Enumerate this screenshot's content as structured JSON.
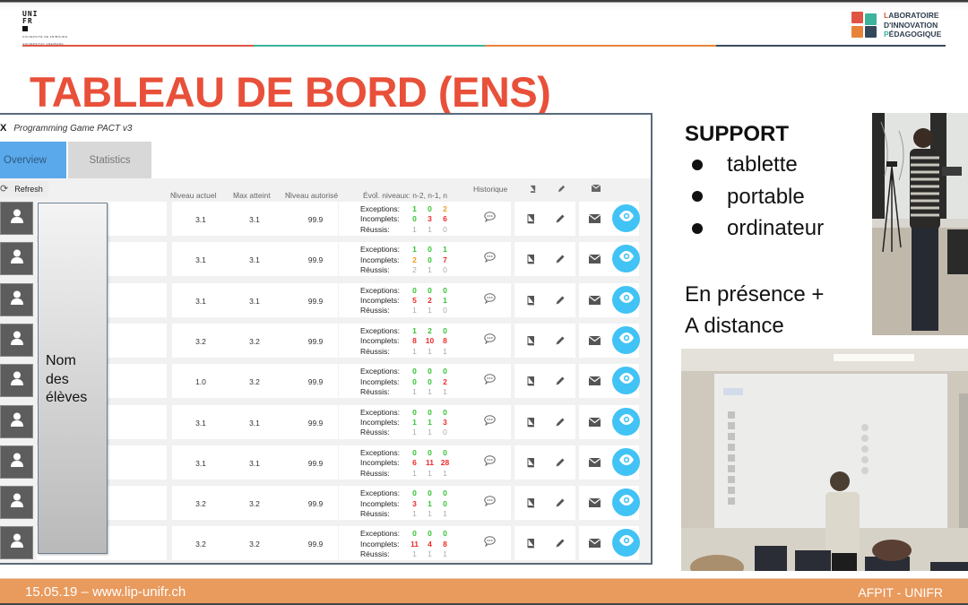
{
  "slide": {
    "title": "TABLEAU DE BORD (ENS)",
    "university_logo": {
      "letters_line1": "UNI",
      "letters_line2": "FR",
      "subtitle_line1": "UNIVERSITÉ DE FRIBOURG",
      "subtitle_line2": "UNIVERSITÄT FREIBURG"
    },
    "lab_logo": {
      "line1_initial": "L",
      "line1_rest": "ABORATOIRE",
      "line2_initial": "D'I",
      "line2_rest": "NNOVATION",
      "line3_initial": "P",
      "line3_rest": "ÉDAGOGIQUE"
    },
    "rule_colors": [
      "#e05443",
      "#3cb39b",
      "#e8843a",
      "#3b4a5c"
    ],
    "footer": {
      "left": "15.05.19 – www.lip-unifr.ch",
      "right": "AFPIT - UNIFR"
    }
  },
  "app": {
    "close_label": "X",
    "title": "Programming Game PACT v3",
    "tabs": [
      {
        "label": "Overview",
        "active": true
      },
      {
        "label": "Statistics",
        "active": false
      }
    ],
    "refresh_label": "Refresh",
    "columns": {
      "niveau_actuel": "Niveau actuel",
      "max_atteint": "Max atteint",
      "niveau_autorise": "Niveau autorisé",
      "evolution": "Évol. niveaux: n-2, n-1, n",
      "historique": "Historique",
      "sort_glyph": "⇕"
    },
    "row_labels": {
      "exceptions": "Exceptions:",
      "incomplets": "Incomplets:",
      "reussis": "Réussis:"
    },
    "name_overlay": [
      "Nom",
      "des",
      "élèves"
    ],
    "accent_color": "#41c3f5",
    "rows": [
      {
        "niveau_actuel": "3.1",
        "max_atteint": "3.1",
        "niveau_autorise": "99.9",
        "exceptions": [
          {
            "v": "1",
            "c": "g"
          },
          {
            "v": "0",
            "c": "g"
          },
          {
            "v": "2",
            "c": "o"
          }
        ],
        "incomplets": [
          {
            "v": "0",
            "c": "g"
          },
          {
            "v": "3",
            "c": "r"
          },
          {
            "v": "6",
            "c": "r"
          }
        ],
        "reussis": [
          {
            "v": "1",
            "c": "z"
          },
          {
            "v": "1",
            "c": "z"
          },
          {
            "v": "0",
            "c": "z"
          }
        ]
      },
      {
        "niveau_actuel": "3.1",
        "max_atteint": "3.1",
        "niveau_autorise": "99.9",
        "exceptions": [
          {
            "v": "1",
            "c": "g"
          },
          {
            "v": "0",
            "c": "g"
          },
          {
            "v": "1",
            "c": "g"
          }
        ],
        "incomplets": [
          {
            "v": "2",
            "c": "o"
          },
          {
            "v": "0",
            "c": "g"
          },
          {
            "v": "7",
            "c": "r"
          }
        ],
        "reussis": [
          {
            "v": "2",
            "c": "z"
          },
          {
            "v": "1",
            "c": "z"
          },
          {
            "v": "0",
            "c": "z"
          }
        ]
      },
      {
        "niveau_actuel": "3.1",
        "max_atteint": "3.1",
        "niveau_autorise": "99.9",
        "exceptions": [
          {
            "v": "0",
            "c": "g"
          },
          {
            "v": "0",
            "c": "g"
          },
          {
            "v": "0",
            "c": "g"
          }
        ],
        "incomplets": [
          {
            "v": "5",
            "c": "r"
          },
          {
            "v": "2",
            "c": "r"
          },
          {
            "v": "1",
            "c": "g"
          }
        ],
        "reussis": [
          {
            "v": "1",
            "c": "z"
          },
          {
            "v": "1",
            "c": "z"
          },
          {
            "v": "0",
            "c": "z"
          }
        ]
      },
      {
        "niveau_actuel": "3.2",
        "max_atteint": "3.2",
        "niveau_autorise": "99.9",
        "exceptions": [
          {
            "v": "1",
            "c": "g"
          },
          {
            "v": "2",
            "c": "g"
          },
          {
            "v": "0",
            "c": "g"
          }
        ],
        "incomplets": [
          {
            "v": "8",
            "c": "r"
          },
          {
            "v": "10",
            "c": "r"
          },
          {
            "v": "8",
            "c": "r"
          }
        ],
        "reussis": [
          {
            "v": "1",
            "c": "z"
          },
          {
            "v": "1",
            "c": "z"
          },
          {
            "v": "1",
            "c": "z"
          }
        ]
      },
      {
        "niveau_actuel": "1.0",
        "max_atteint": "3.2",
        "niveau_autorise": "99.9",
        "exceptions": [
          {
            "v": "0",
            "c": "g"
          },
          {
            "v": "0",
            "c": "g"
          },
          {
            "v": "0",
            "c": "g"
          }
        ],
        "incomplets": [
          {
            "v": "0",
            "c": "g"
          },
          {
            "v": "0",
            "c": "g"
          },
          {
            "v": "2",
            "c": "r"
          }
        ],
        "reussis": [
          {
            "v": "1",
            "c": "z"
          },
          {
            "v": "1",
            "c": "z"
          },
          {
            "v": "1",
            "c": "z"
          }
        ]
      },
      {
        "niveau_actuel": "3.1",
        "max_atteint": "3.1",
        "niveau_autorise": "99.9",
        "exceptions": [
          {
            "v": "0",
            "c": "g"
          },
          {
            "v": "0",
            "c": "g"
          },
          {
            "v": "0",
            "c": "g"
          }
        ],
        "incomplets": [
          {
            "v": "1",
            "c": "g"
          },
          {
            "v": "1",
            "c": "g"
          },
          {
            "v": "3",
            "c": "r"
          }
        ],
        "reussis": [
          {
            "v": "1",
            "c": "z"
          },
          {
            "v": "1",
            "c": "z"
          },
          {
            "v": "0",
            "c": "z"
          }
        ]
      },
      {
        "niveau_actuel": "3.1",
        "max_atteint": "3.1",
        "niveau_autorise": "99.9",
        "exceptions": [
          {
            "v": "0",
            "c": "g"
          },
          {
            "v": "0",
            "c": "g"
          },
          {
            "v": "0",
            "c": "g"
          }
        ],
        "incomplets": [
          {
            "v": "6",
            "c": "r"
          },
          {
            "v": "11",
            "c": "r"
          },
          {
            "v": "28",
            "c": "r"
          }
        ],
        "reussis": [
          {
            "v": "1",
            "c": "z"
          },
          {
            "v": "1",
            "c": "z"
          },
          {
            "v": "1",
            "c": "z"
          }
        ]
      },
      {
        "niveau_actuel": "3.2",
        "max_atteint": "3.2",
        "niveau_autorise": "99.9",
        "exceptions": [
          {
            "v": "0",
            "c": "g"
          },
          {
            "v": "0",
            "c": "g"
          },
          {
            "v": "0",
            "c": "g"
          }
        ],
        "incomplets": [
          {
            "v": "3",
            "c": "r"
          },
          {
            "v": "1",
            "c": "g"
          },
          {
            "v": "0",
            "c": "g"
          }
        ],
        "reussis": [
          {
            "v": "1",
            "c": "z"
          },
          {
            "v": "1",
            "c": "z"
          },
          {
            "v": "1",
            "c": "z"
          }
        ]
      },
      {
        "niveau_actuel": "3.2",
        "max_atteint": "3.2",
        "niveau_autorise": "99.9",
        "exceptions": [
          {
            "v": "0",
            "c": "g"
          },
          {
            "v": "0",
            "c": "g"
          },
          {
            "v": "0",
            "c": "g"
          }
        ],
        "incomplets": [
          {
            "v": "11",
            "c": "r"
          },
          {
            "v": "4",
            "c": "r"
          },
          {
            "v": "8",
            "c": "r"
          }
        ],
        "reussis": [
          {
            "v": "1",
            "c": "z"
          },
          {
            "v": "1",
            "c": "z"
          },
          {
            "v": "1",
            "c": "z"
          }
        ]
      }
    ]
  },
  "support": {
    "heading": "SUPPORT",
    "items": [
      "tablette",
      "portable",
      "ordinateur"
    ],
    "mode_line1": "En présence +",
    "mode_line2": "A distance"
  },
  "photos": {
    "photo1": "teacher-holding-tablet",
    "photo2": "teacher-in-front-of-projected-dashboard"
  }
}
